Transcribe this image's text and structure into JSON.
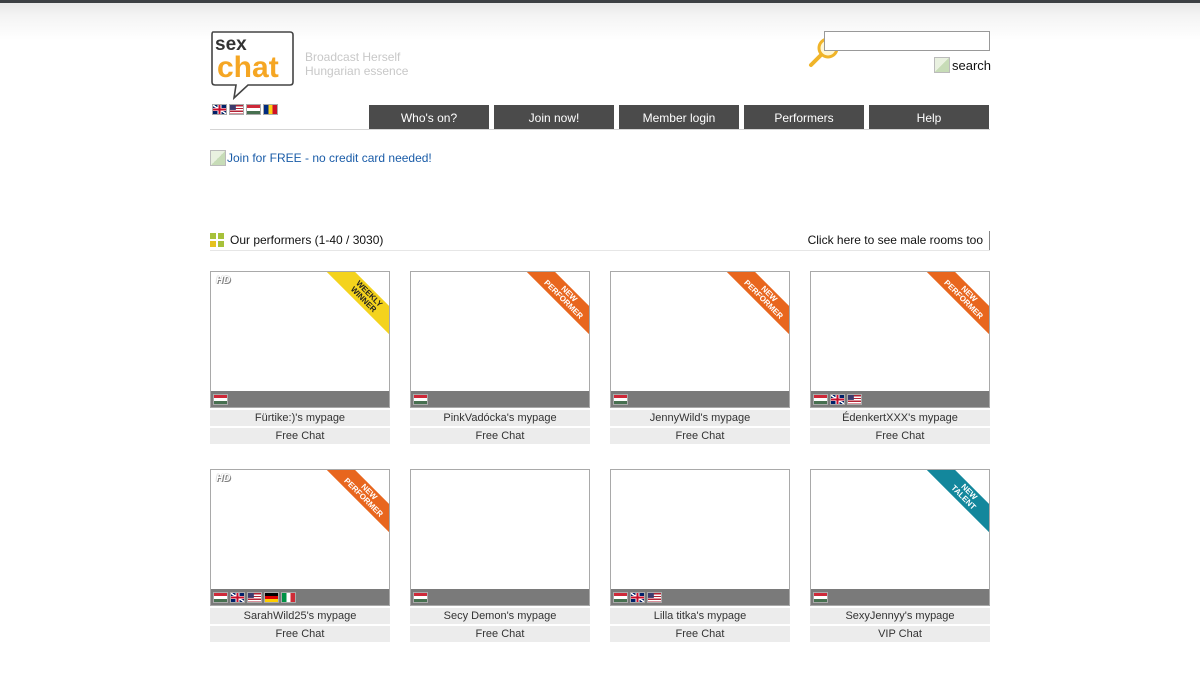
{
  "header": {
    "logo_word_top": "sex",
    "logo_word_bottom": "chat",
    "tagline_line1": "Broadcast Herself",
    "tagline_line2": "Hungarian essence",
    "language_flags": [
      "uk-flag",
      "us-flag",
      "hu-flag",
      "ro-flag"
    ]
  },
  "search": {
    "input_value": "",
    "button_label": "search"
  },
  "nav": {
    "items": [
      "Who's on?",
      "Join now!",
      "Member login",
      "Performers",
      "Help"
    ]
  },
  "banner": {
    "join_free": "Join for FREE - no credit card needed!"
  },
  "section": {
    "title": "Our performers (1-40 / 3030)",
    "male_rooms_link": "Click here to see male rooms too"
  },
  "performers": [
    {
      "name": "Fürtike:)'s mypage",
      "chat": "Free Chat",
      "hd": "HD",
      "ribbon": "WEEKLY WINNER",
      "flags": [
        "hu"
      ]
    },
    {
      "name": "PinkVadócka's mypage",
      "chat": "Free Chat",
      "hd": "",
      "ribbon": "NEW PERFORMER",
      "flags": [
        "hu"
      ]
    },
    {
      "name": "JennyWild's mypage",
      "chat": "Free Chat",
      "hd": "",
      "ribbon": "NEW PERFORMER",
      "flags": [
        "hu"
      ]
    },
    {
      "name": "ÉdenkertXXX's mypage",
      "chat": "Free Chat",
      "hd": "",
      "ribbon": "NEW PERFORMER",
      "flags": [
        "hu",
        "uk",
        "us"
      ]
    },
    {
      "name": "SarahWild25's mypage",
      "chat": "Free Chat",
      "hd": "HD",
      "ribbon": "NEW PERFORMER",
      "flags": [
        "hu",
        "uk",
        "us",
        "de",
        "it"
      ]
    },
    {
      "name": "Secy Demon's mypage",
      "chat": "Free Chat",
      "hd": "",
      "ribbon": "",
      "flags": [
        "hu"
      ]
    },
    {
      "name": "Lilla titka's mypage",
      "chat": "Free Chat",
      "hd": "",
      "ribbon": "",
      "flags": [
        "hu",
        "uk",
        "us"
      ]
    },
    {
      "name": "SexyJennyy's mypage",
      "chat": "VIP Chat",
      "hd": "",
      "ribbon": "NEW TALENT",
      "flags": [
        "hu"
      ]
    }
  ],
  "colors": {
    "nav_bg": "#4b4b4b",
    "logo_orange": "#f5a623",
    "link_blue": "#1a5ca8",
    "ribbon_new": "#e8661e",
    "ribbon_weekly": "#f4d31d",
    "ribbon_talent": "#13879c"
  }
}
